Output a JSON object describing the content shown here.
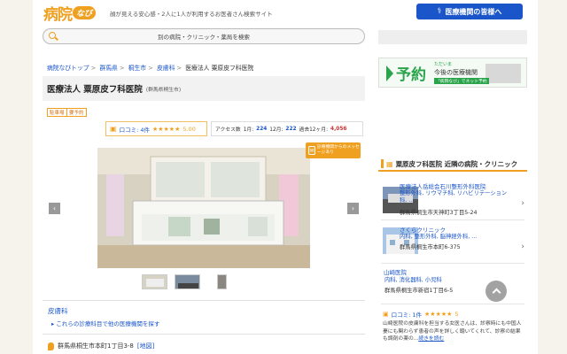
{
  "header": {
    "logo_kanji": "病院",
    "logo_navi": "なび",
    "tagline": "顔が見える安心感・2人に1人が利用するお医者さん検索サイト",
    "pro_button": "医療機関の皆様へ"
  },
  "search": {
    "placeholder": "別の病院・クリニック・薬局を検索"
  },
  "breadcrumb": [
    "病院なびトップ",
    "群馬県",
    "桐生市",
    "皮膚科",
    "医療法人 粟原皮フ科医院"
  ],
  "title": {
    "main": "医療法人 粟原皮フ科医院",
    "sub": "(群馬県桐生市)"
  },
  "tags": [
    "駐車場",
    "要予約"
  ],
  "reviews": {
    "label": "口コミ: 4件",
    "stars": "★★★★★",
    "score": "5.00"
  },
  "access": {
    "label": "アクセス数",
    "d1_label": "1月:",
    "d1": "224",
    "m12_label": "12月:",
    "m12": "222",
    "y_label": "過去12ヶ月:",
    "year": "4,056"
  },
  "message_badge": "診療機関からのメッセージあり",
  "nav": {
    "prev": "‹",
    "next": "›"
  },
  "specialty": {
    "name": "皮膚科",
    "sub_link": "▸ これらの診療科目で他の医療機関を探す"
  },
  "address": {
    "text": "群馬県桐生市本町1丁目3-8",
    "map": "[地図]"
  },
  "sidebar": {
    "ad_text": "予約",
    "ad_small": "ただいま",
    "ad_label": "今後の医療機関",
    "ad_caption": "「病院なび」でネット予約",
    "near_title": "粟原皮フ科医院 近隣の病院・クリニック",
    "clinics": [
      {
        "name": "医療法人岳総会石川整形外科医院",
        "dept": "整形外科, リウマチ科, リハビリテーション科, ...",
        "addr": "群馬県桐生市天神町3丁目5-24"
      },
      {
        "name": "さくらクリニック",
        "dept": "内科, 整形外科, 脳神経外科, ...",
        "addr": "群馬県桐生市本町6-375"
      },
      {
        "name": "山崎医院",
        "dept": "内科, 消化器科, 小児科",
        "addr": "群馬県桐生市新宿1丁目6-5"
      }
    ],
    "review_label": "口コミ: 1件",
    "review_stars": "★★★★★",
    "review_score": "5",
    "review_text": "山崎医院の皮膚科を担当する女医さんは、診察時にも中国人妻にも関わらず患者の声を詳しく聴いてくれて、診察の結果も調剤の薬の...",
    "review_more": "続きを読む"
  },
  "colors": {
    "accent": "#f0a020",
    "link": "#1a55c9",
    "pro_button": "#1a55c9"
  }
}
